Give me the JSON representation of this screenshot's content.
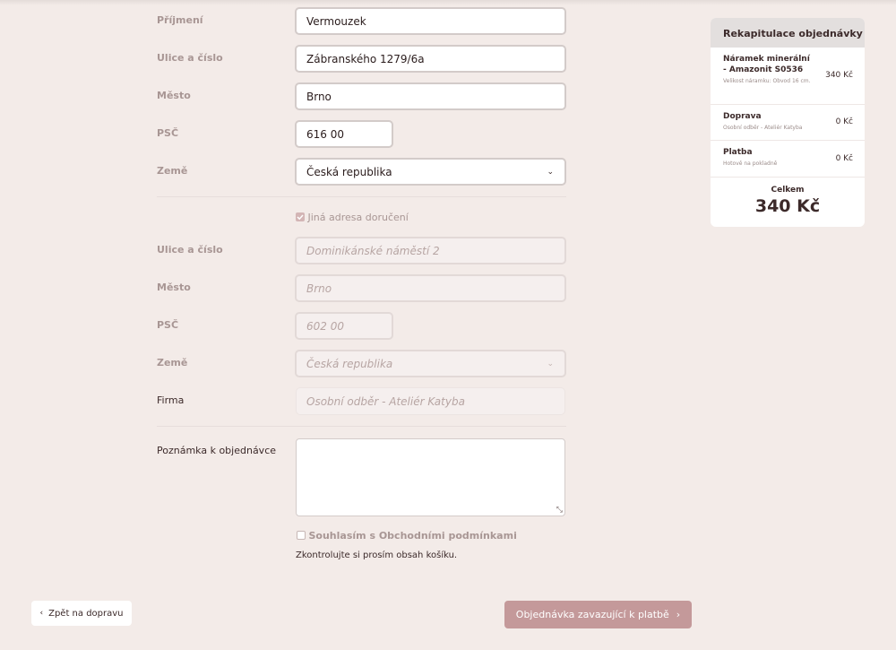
{
  "billing": {
    "surname_label": "Příjmení",
    "surname_value": "Vermouzek",
    "street_label": "Ulice a číslo",
    "street_value": "Zábranského 1279/6a",
    "city_label": "Město",
    "city_value": "Brno",
    "zip_label": "PSČ",
    "zip_value": "616 00",
    "country_label": "Země",
    "country_value": "Česká republika"
  },
  "delivery": {
    "checkbox_label": "Jiná adresa doručení",
    "checkbox_checked": true,
    "street_label": "Ulice a číslo",
    "street_placeholder": "Dominikánské náměstí 2",
    "city_label": "Město",
    "city_placeholder": "Brno",
    "zip_label": "PSČ",
    "zip_placeholder": "602 00",
    "country_label": "Země",
    "country_value": "Česká republika",
    "company_label": "Firma",
    "company_placeholder": "Osobní odběr - Ateliér Katyba"
  },
  "note": {
    "label": "Poznámka k objednávce",
    "value": ""
  },
  "terms": {
    "prefix": "Souhlasím s ",
    "link": "Obchodními podmínkami",
    "checked": false,
    "warning": "Zkontrolujte si prosím obsah košíku."
  },
  "summary": {
    "title": "Rekapitulace objednávky",
    "product_name": "Náramek minerální - Amazonit S0536",
    "product_detail": "Velikost náramku: Obvod 16 cm.",
    "product_price": "340 Kč",
    "shipping_name": "Doprava",
    "shipping_detail": "Osobní odběr - Ateliér Katyba",
    "shipping_price": "0 Kč",
    "payment_name": "Platba",
    "payment_detail": "Hotově na pokladně",
    "payment_price": "0 Kč",
    "total_label": "Celkem",
    "total_value": "340 Kč"
  },
  "nav": {
    "back_label": "Zpět na dopravu",
    "back_icon": "chevron-left-icon",
    "order_label": "Objednávka zavazující k platbě",
    "order_icon": "chevron-right-icon"
  },
  "colors": {
    "background": "#f3ebe8",
    "accent_button": "#c4999a",
    "checkbox_checked": "#d3b5b5"
  }
}
